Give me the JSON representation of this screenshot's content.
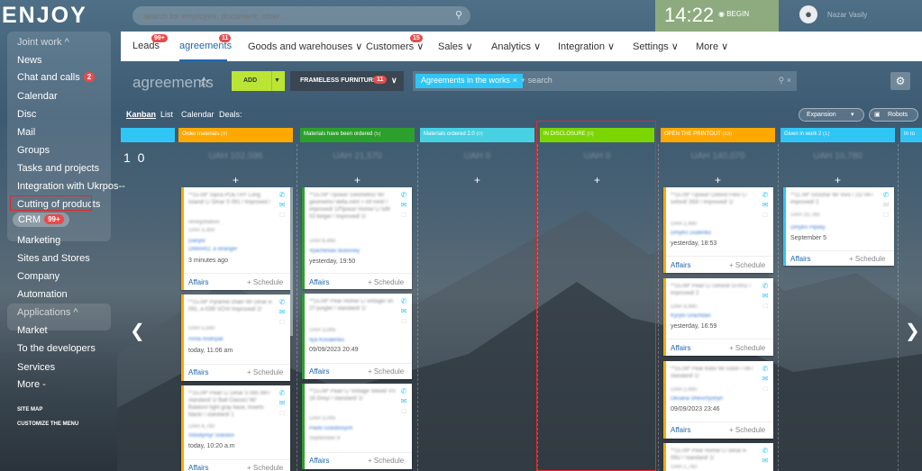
{
  "app": {
    "logo": "ENJOY",
    "search_placeholder": "search for employee, document, other...",
    "clock": "14:22",
    "begin_label": "BEGIN",
    "user_name": "Nazar Vasily"
  },
  "sidebar": {
    "items": [
      {
        "label": "Joint work ^"
      },
      {
        "label": "News"
      },
      {
        "label": "Chat and calls",
        "badge": "2"
      },
      {
        "label": "Calendar"
      },
      {
        "label": "Disc"
      },
      {
        "label": "Mail"
      },
      {
        "label": "Groups"
      },
      {
        "label": "Tasks and projects"
      },
      {
        "label": "Integration with Ukrpos--"
      },
      {
        "label": "Cutting of products"
      },
      {
        "label": "CRM",
        "badge": "99+"
      },
      {
        "label": "Marketing"
      },
      {
        "label": "Sites and Stores"
      },
      {
        "label": "Company"
      },
      {
        "label": "Automation"
      },
      {
        "label": "Applications ^"
      },
      {
        "label": "Market"
      },
      {
        "label": "To the developers"
      },
      {
        "label": "Services"
      },
      {
        "label": "More -"
      }
    ],
    "site_map": "SITE MAP",
    "customize": "CUSTOMIZE THE MENU"
  },
  "tabs": [
    {
      "label": "Leads",
      "badge": "99+"
    },
    {
      "label": "agreements",
      "badge": "11"
    },
    {
      "label": "Goods and warehouses ∨"
    },
    {
      "label": "Customers ∨",
      "badge": "15"
    },
    {
      "label": "Sales ∨"
    },
    {
      "label": "Analytics ∨"
    },
    {
      "label": "Integration ∨"
    },
    {
      "label": "Settings ∨"
    },
    {
      "label": "More ∨"
    }
  ],
  "toolbar": {
    "title": "agreements",
    "add_label": "ADD",
    "filter_label": "FRAMELESS FURNITURE",
    "filter_count": "11",
    "filter_tag": "Agreements in the works",
    "search_placeholder": "+ search",
    "view_tabs": [
      "Kanban",
      "List",
      "Calendar",
      "Deals:"
    ],
    "expansion_label": "Expansion",
    "robots_label": "Robots"
  },
  "big_number": "1 0",
  "stages": [
    {
      "name": "",
      "count": "",
      "color": "#2fc6f6",
      "sum": ""
    },
    {
      "name": "Order materials",
      "count": "(9)",
      "color": "#ffa900",
      "sum": "UAH 102,596"
    },
    {
      "name": "Materials have been ordered",
      "count": "(5)",
      "color": "#2ca02c",
      "sum": "UAH 21,570"
    },
    {
      "name": "Materials ordered 2.0",
      "count": "(0)",
      "color": "#47d1e2",
      "sum": "UAH 0"
    },
    {
      "name": "IN DISCLOSURE",
      "count": "(0)",
      "color": "#7bd500",
      "sum": "UAH 0"
    },
    {
      "name": "OPEN THE PRINTOUT",
      "count": "(33)",
      "color": "#ffa900",
      "sum": "UAH 140,070"
    },
    {
      "name": "Given in work 2",
      "count": "(1)",
      "color": "#2fc6f6",
      "sum": "UAH 10,780"
    },
    {
      "name": "In ro",
      "count": "",
      "color": "#2fc6f6",
      "sum": ""
    }
  ],
  "cards": [
    {
      "title": "**15.09* Sipca POETRY Long Island/ L/ Dinar S 091 / Improved /",
      "line1": "renegotiation",
      "line1b": "UAH 3,350",
      "person": "Danylo",
      "person2": "DIMARO, a stranger",
      "date": "3 minutes ago",
      "affairs": "Affairs",
      "schedule": "+ Schedule"
    },
    {
      "title": "**15.09* Pyramid chair/ W/ Dinar e-091, e-039/ VCH/ Improved/ 2/",
      "line1": "UAH 5,590",
      "person": "Anna Andriyak",
      "date": "today, 11:06 am",
      "affairs": "Affairs",
      "schedule": "+ Schedule"
    },
    {
      "title": "**15.09* Pear/ L/ Dinar S 085 WF/ standard/ 1/ Ball Classic/ W/ Balaton/ light gray base, inserts black/ / standard/ 1",
      "line1": "UAH 4,790",
      "person": "Volodymyr Sokolov",
      "date": "today, 10:20 a.m",
      "affairs": "Affairs",
      "schedule": "+ Schedule"
    },
    {
      "title": "**15.09* Прокат Geometric/ W/ geometric/ delta mint + mf mint/ / improved/ 1/Прокат Home/ L/ loft/ 02-beige/ / improved/ 1/",
      "line1": "UAH 6,490",
      "person": "Vyacheslav Bulovsky",
      "date": "yesterday, 19:50",
      "affairs": "Affairs",
      "schedule": "+ Schedule"
    },
    {
      "title": "**15.09* Pear Home/ L/ vintage/ on 27-jungle/ / standard/ 1/",
      "line1": "UAH 3,095",
      "person": "Ilya Kovalenko",
      "date": "09/09/2023 20:49",
      "affairs": "Affairs",
      "schedule": "+ Schedule"
    },
    {
      "title": "**15.09* Pear/ L/ Vintage Velvet/ VV 16 Grey/ / standard/ 1/",
      "line1": "UAH 3,095",
      "person": "Pavlo Golubovych",
      "date": "September 8",
      "affairs": "Affairs",
      "schedule": "+ Schedule"
    },
    {
      "title": "**15.09* Прокат Oxford Flex/ L/ oxford/ 263/ / improved/ 1/",
      "line1": "UAH 2,490",
      "person": "Dmytro Dudenko",
      "date": "yesterday, 18:53",
      "affairs": "Affairs",
      "schedule": "+ Schedule"
    },
    {
      "title": "**15.09* Pear/ L/ Oxford/ O-001/ / improved/ 2",
      "line1": "UAH 4,990",
      "person": "Kyrylo Grachdan",
      "date": "yesterday, 16:59",
      "affairs": "Affairs",
      "schedule": "+ Schedule"
    },
    {
      "title": "**15.09* Pear Kids/ W/ color/ / HF/ standard/ 1/",
      "line1": "UAH 2,490",
      "person": "Oksana Shevchyshyn",
      "date": "09/09/2023 23:46",
      "affairs": "Affairs",
      "schedule": "+ Schedule"
    },
    {
      "title": "**15.09* Pear Home/ L/ stina/ e-091/ / standard/ 1/",
      "line1": "UAH 2,790",
      "person": "",
      "date": "",
      "affairs": "",
      "schedule": ""
    },
    {
      "title": "**11.09* Grusha/ W/ Vivo / 21/ HF/ improved/ 2",
      "line1": "UAH 10,780",
      "person": "Dmytro Pipsky",
      "date": "September 5",
      "affairs": "Affairs",
      "schedule": "+ Schedule"
    }
  ],
  "colors": {
    "accent": "#2067b0",
    "badge": "#e94a4a",
    "add": "#bbe535",
    "highlight": "#e02a2a"
  },
  "icons": {
    "search": "search-icon",
    "phone": "phone-icon",
    "mail": "mail-icon",
    "chat": "chat-icon",
    "star": "star-icon",
    "gear": "gear-icon",
    "left": "chevron-left-icon",
    "right": "chevron-right-icon"
  }
}
